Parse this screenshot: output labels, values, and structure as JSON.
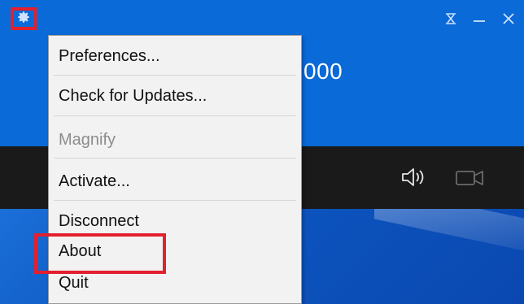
{
  "window": {
    "number_partial": "000"
  },
  "menu": {
    "items": [
      {
        "label": "Preferences...",
        "enabled": true
      },
      {
        "label": "Check for Updates...",
        "enabled": true
      },
      {
        "label": "Magnify",
        "enabled": false
      },
      {
        "label": "Activate...",
        "enabled": true
      },
      {
        "label": "Disconnect",
        "enabled": true
      },
      {
        "label": "About",
        "enabled": true
      },
      {
        "label": "Quit",
        "enabled": true
      }
    ]
  },
  "colors": {
    "title_blue": "#0a6ad8",
    "highlight_red": "#e3202d",
    "toolbar_dark": "#1a1a1a",
    "menu_bg": "#f2f2f2"
  },
  "icons": [
    "gear-icon",
    "pin-icon",
    "minimize-icon",
    "close-icon",
    "speaker-icon",
    "video-camera-icon"
  ]
}
